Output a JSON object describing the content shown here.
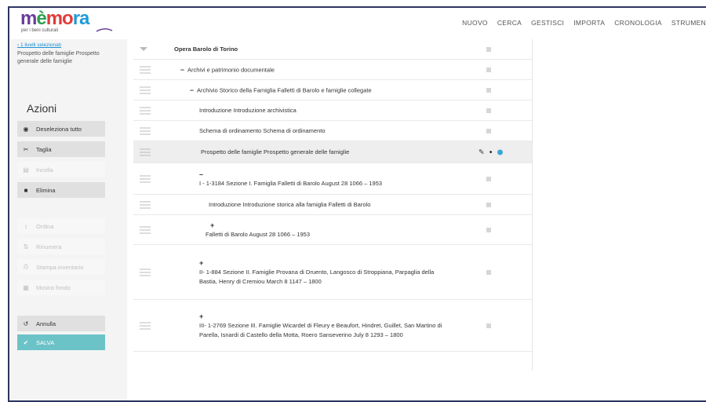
{
  "logo": {
    "name_parts": [
      "m",
      "è",
      "mo",
      "ra"
    ],
    "subtitle": "per i beni culturali"
  },
  "nav": [
    "NUOVO",
    "CERCA",
    "GESTISCI",
    "IMPORTA",
    "CRONOLOGIA",
    "STRUMEN"
  ],
  "selection": {
    "link": "‹ 1 livelli selezionati",
    "description": "Prospetto delle famiglie Prospetto generale delle famiglie"
  },
  "azioni": {
    "title": "Azioni",
    "items": [
      {
        "label": "Deseleziona tutto",
        "icon": "circle-dot-icon",
        "glyph": "◉",
        "enabled": true
      },
      {
        "label": "Taglia",
        "icon": "scissors-icon",
        "glyph": "✂",
        "enabled": true
      },
      {
        "label": "Incolla",
        "icon": "paste-icon",
        "glyph": "▤",
        "enabled": false
      },
      {
        "label": "Elimina",
        "icon": "trash-icon",
        "glyph": "■",
        "enabled": true
      },
      {
        "label": "Ordina",
        "icon": "sort-icon",
        "glyph": "↕",
        "enabled": false
      },
      {
        "label": "Rinumera",
        "icon": "renumber-icon",
        "glyph": "⇅",
        "enabled": false
      },
      {
        "label": "Stampa inventario",
        "icon": "print-icon",
        "glyph": "⎙",
        "enabled": false
      },
      {
        "label": "Mostra fondo",
        "icon": "grid-icon",
        "glyph": "▦",
        "enabled": false
      },
      {
        "label": "Annulla",
        "icon": "undo-icon",
        "glyph": "↺",
        "enabled": true
      },
      {
        "label": "SALVA",
        "icon": "check-circle-icon",
        "glyph": "✔",
        "enabled": true
      }
    ]
  },
  "tree": [
    {
      "text": "Opera Barolo di Torino",
      "toggle": "",
      "level": 0,
      "bold": true
    },
    {
      "text": "Archivi e patrimonio documentale",
      "toggle": "–",
      "level": 1
    },
    {
      "text": "Archivio Storico della Famiglia Falletti di Barolo e famiglie collegate",
      "toggle": "–",
      "level": 2
    },
    {
      "text": "Introduzione Introduzione archivistica",
      "toggle": "",
      "level": 3
    },
    {
      "text": "Schema di ordinamento Schema di ordinamento",
      "toggle": "",
      "level": 3
    },
    {
      "text": "Prospetto delle famiglie Prospetto generale delle famiglie",
      "toggle": "",
      "level": 3,
      "selected": true
    },
    {
      "text": "I - 1-3184 Sezione I. Famiglia Falletti di Barolo August 28 1066 – 1953",
      "toggle": "–",
      "level": 3
    },
    {
      "text": "Introduzione Introduzione storica alla famiglia Falletti di Barolo",
      "toggle": "",
      "level": 4
    },
    {
      "text": "Falletti di Barolo August 28 1066 – 1953",
      "toggle": "+",
      "level": 4
    },
    {
      "text": "II- 1-884 Sezione II. Famiglie Provana di Druento, Langosco di Stroppiana, Parpaglia della Bastia, Henry di Cremiou March 8 1147 – 1800",
      "toggle": "+",
      "level": 3
    },
    {
      "text": "III- 1-2769 Sezione III. Famiglie Wicardel di Fleury e Beaufort, Hindret, Guillet, San Martino di Parella, Isnardi di Castello della Motta, Roero Sanseverino July 8 1293 – 1800",
      "toggle": "+",
      "level": 3
    }
  ]
}
